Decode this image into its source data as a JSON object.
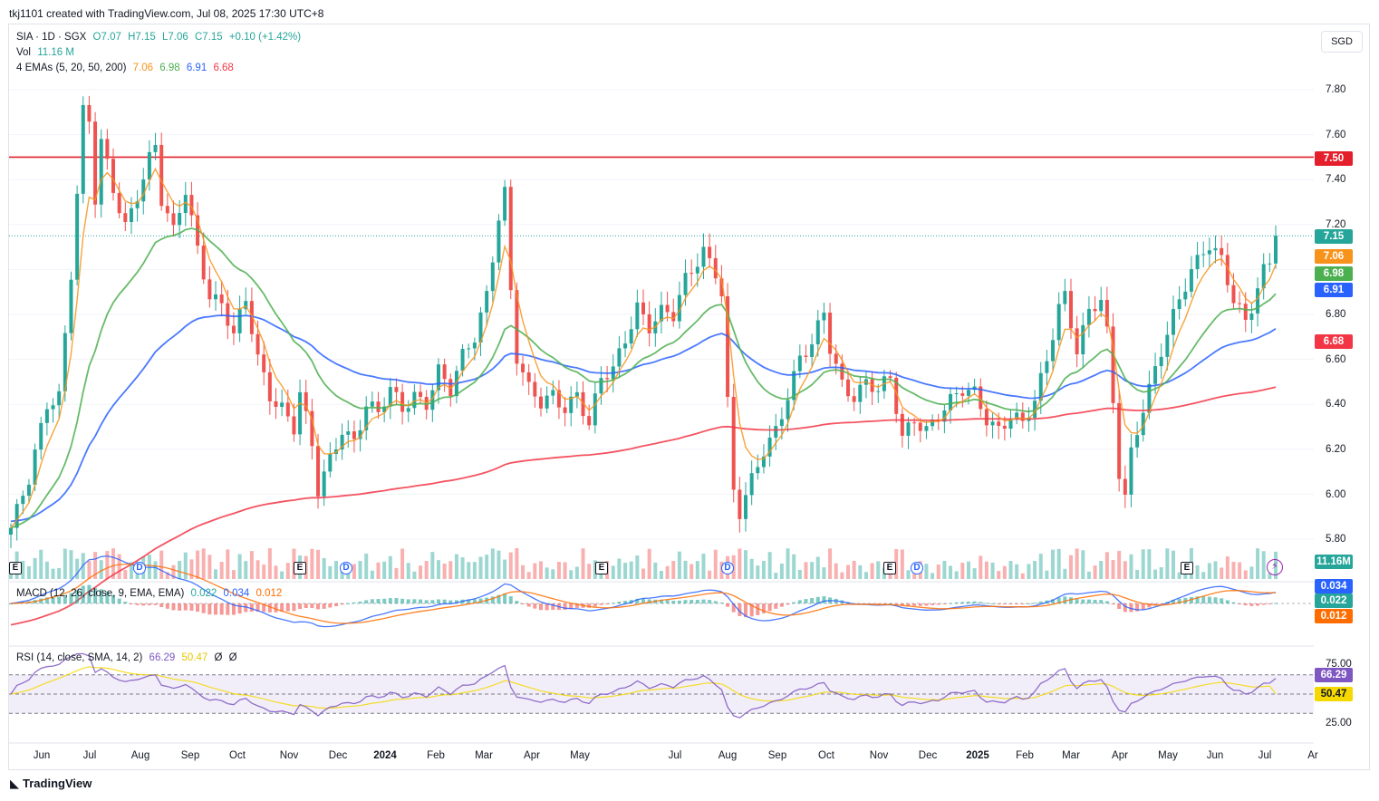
{
  "header": "tkj1101 created with TradingView.com, Jul 08, 2025 17:30 UTC+8",
  "currency": "SGD",
  "legend": {
    "symbol": "SIA · 1D · SGX",
    "open": "O7.07",
    "high": "H7.15",
    "low": "L7.06",
    "close": "C7.15",
    "change": "+0.10 (+1.42%)",
    "vol_label": "Vol",
    "vol_value": "11.16 M",
    "ema_label": "4 EMAs (5, 20, 50, 200)",
    "ema5": "7.06",
    "ema20": "6.98",
    "ema50": "6.91",
    "ema200": "6.68",
    "macd_label": "MACD (12, 26, close, 9, EMA, EMA)",
    "macd_hist": "0.022",
    "macd_line": "0.034",
    "macd_signal": "0.012",
    "rsi_label": "RSI (14, close, SMA, 14, 2)",
    "rsi_value": "66.29",
    "rsi_ma": "50.47",
    "rsi_extra1": "Ø",
    "rsi_extra2": "Ø"
  },
  "badges": {
    "resistance": "7.50",
    "last": "7.15",
    "ema5": "7.06",
    "ema20": "6.98",
    "ema50": "6.91",
    "ema200": "6.68",
    "volume": "11.16M",
    "macd_line": "0.034",
    "macd_hist": "0.022",
    "macd_signal": "0.012",
    "rsi": "66.29",
    "rsi_ma": "50.47"
  },
  "colors": {
    "up": "#26a69a",
    "down": "#ef5350",
    "ema5": "#f7931a",
    "ema20": "#4caf50",
    "ema50": "#2962ff",
    "ema200": "#f23645",
    "resistance": "#e41e2a",
    "macd": "#2962ff",
    "signal": "#ff6d00",
    "rsi": "#7e57c2",
    "rsi_ma": "#f5d800"
  },
  "y_ticks": [
    "7.80",
    "7.60",
    "7.40",
    "7.20",
    "6.80",
    "6.60",
    "6.40",
    "6.20",
    "6.00",
    "5.80"
  ],
  "rsi_ticks": [
    "75.00",
    "25.00"
  ],
  "x_ticks": [
    "Jun",
    "Jul",
    "Aug",
    "Sep",
    "Oct",
    "Nov",
    "Dec",
    "2024",
    "Feb",
    "Mar",
    "Apr",
    "May",
    "Jul",
    "Aug",
    "Sep",
    "Oct",
    "Nov",
    "Dec",
    "2025",
    "Feb",
    "Mar",
    "Apr",
    "May",
    "Jun",
    "Jul",
    "Ar"
  ],
  "event_markers": [
    "E",
    "D",
    "E",
    "D",
    "E",
    "D",
    "E",
    "D",
    "E"
  ],
  "branding": "TradingView",
  "chart_data": [
    {
      "type": "candlestick",
      "title": "SIA · 1D · SGX",
      "ylim": [
        5.72,
        8.0
      ],
      "resistance_line": 7.5,
      "last_close": 7.15,
      "anchors": [
        [
          0,
          5.85
        ],
        [
          3,
          6.05
        ],
        [
          6,
          6.4
        ],
        [
          8,
          6.45
        ],
        [
          10,
          7.0
        ],
        [
          12,
          7.7
        ],
        [
          13,
          7.65
        ],
        [
          14,
          7.3
        ],
        [
          15,
          7.55
        ],
        [
          17,
          7.35
        ],
        [
          19,
          7.2
        ],
        [
          21,
          7.35
        ],
        [
          23,
          7.5
        ],
        [
          24,
          7.55
        ],
        [
          25,
          7.3
        ],
        [
          27,
          7.15
        ],
        [
          29,
          7.35
        ],
        [
          31,
          7.1
        ],
        [
          33,
          6.9
        ],
        [
          35,
          6.85
        ],
        [
          37,
          6.7
        ],
        [
          39,
          6.85
        ],
        [
          41,
          6.6
        ],
        [
          43,
          6.45
        ],
        [
          45,
          6.4
        ],
        [
          47,
          6.3
        ],
        [
          48,
          6.45
        ],
        [
          50,
          6.2
        ],
        [
          51,
          6.0
        ],
        [
          53,
          6.15
        ],
        [
          55,
          6.3
        ],
        [
          57,
          6.25
        ],
        [
          59,
          6.4
        ],
        [
          61,
          6.35
        ],
        [
          63,
          6.45
        ],
        [
          65,
          6.38
        ],
        [
          67,
          6.45
        ],
        [
          69,
          6.42
        ],
        [
          71,
          6.55
        ],
        [
          73,
          6.45
        ],
        [
          75,
          6.6
        ],
        [
          77,
          6.7
        ],
        [
          79,
          6.9
        ],
        [
          81,
          7.25
        ],
        [
          82,
          7.35
        ],
        [
          83,
          6.9
        ],
        [
          84,
          6.6
        ],
        [
          86,
          6.45
        ],
        [
          88,
          6.4
        ],
        [
          90,
          6.45
        ],
        [
          92,
          6.4
        ],
        [
          94,
          6.45
        ],
        [
          96,
          6.3
        ],
        [
          98,
          6.5
        ],
        [
          100,
          6.55
        ],
        [
          102,
          6.7
        ],
        [
          104,
          6.85
        ],
        [
          106,
          6.75
        ],
        [
          108,
          6.8
        ],
        [
          110,
          6.78
        ],
        [
          112,
          6.95
        ],
        [
          114,
          7.05
        ],
        [
          115,
          7.1
        ],
        [
          117,
          7.0
        ],
        [
          118,
          6.9
        ],
        [
          119,
          6.4
        ],
        [
          120,
          6.0
        ],
        [
          121,
          5.9
        ],
        [
          123,
          6.05
        ],
        [
          125,
          6.2
        ],
        [
          127,
          6.3
        ],
        [
          129,
          6.45
        ],
        [
          131,
          6.6
        ],
        [
          133,
          6.65
        ],
        [
          135,
          6.8
        ],
        [
          136,
          6.65
        ],
        [
          138,
          6.5
        ],
        [
          140,
          6.45
        ],
        [
          142,
          6.5
        ],
        [
          144,
          6.45
        ],
        [
          146,
          6.5
        ],
        [
          148,
          6.25
        ],
        [
          150,
          6.35
        ],
        [
          152,
          6.3
        ],
        [
          154,
          6.35
        ],
        [
          156,
          6.4
        ],
        [
          158,
          6.45
        ],
        [
          160,
          6.45
        ],
        [
          162,
          6.35
        ],
        [
          164,
          6.3
        ],
        [
          166,
          6.35
        ],
        [
          168,
          6.3
        ],
        [
          170,
          6.4
        ],
        [
          172,
          6.6
        ],
        [
          174,
          6.85
        ],
        [
          175,
          6.9
        ],
        [
          177,
          6.65
        ],
        [
          179,
          6.8
        ],
        [
          181,
          6.85
        ],
        [
          182,
          6.7
        ],
        [
          183,
          6.4
        ],
        [
          184,
          6.1
        ],
        [
          185,
          6.0
        ],
        [
          186,
          6.2
        ],
        [
          188,
          6.4
        ],
        [
          190,
          6.55
        ],
        [
          192,
          6.7
        ],
        [
          194,
          6.85
        ],
        [
          196,
          7.0
        ],
        [
          198,
          7.1
        ],
        [
          199,
          7.13
        ],
        [
          201,
          7.05
        ],
        [
          202,
          6.95
        ],
        [
          203,
          6.85
        ],
        [
          205,
          6.75
        ],
        [
          206,
          6.82
        ],
        [
          208,
          7.0
        ],
        [
          209,
          7.05
        ],
        [
          210,
          7.15
        ]
      ],
      "volume_last": "11.16M",
      "indicators": {
        "ema5": 7.06,
        "ema20": 6.98,
        "ema50": 6.91,
        "ema200": 6.68,
        "macd_line": 0.034,
        "macd_histogram": 0.022,
        "macd_signal": 0.012,
        "rsi": 66.29,
        "rsi_ma": 50.47,
        "rsi_levels": [
          70,
          50,
          30
        ]
      }
    }
  ]
}
